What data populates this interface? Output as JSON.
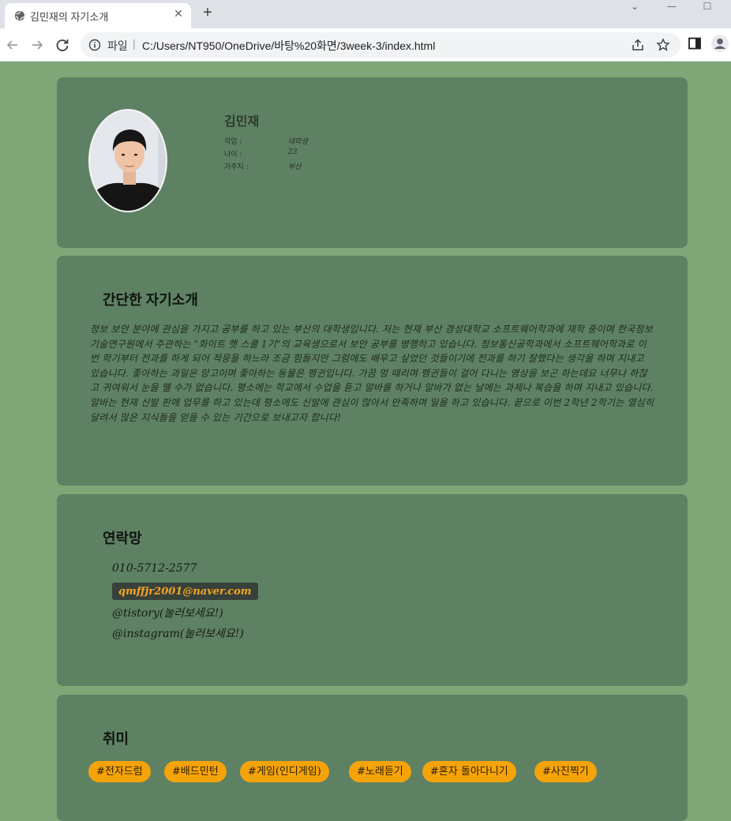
{
  "browser": {
    "tab_title": "김민재의 자기소개",
    "new_tab_glyph": "+",
    "close_glyph": "✕",
    "omnibox": {
      "scheme_label": "파일",
      "separator": "|",
      "url": "C:/Users/NT950/OneDrive/바탕%20화면/3week-3/index.html"
    },
    "window_controls": {
      "chevron": "⌄",
      "minimize": "—",
      "maximize": "☐"
    }
  },
  "profile": {
    "name": "김민재",
    "fields": [
      {
        "label": "직업 :",
        "value": "대학생"
      },
      {
        "label": "나이 :",
        "value": "23"
      },
      {
        "label": "거주지 :",
        "value": "부산"
      }
    ]
  },
  "intro": {
    "title": "간단한 자기소개",
    "body": "정보 보안 분야에 관심을 가지고 공부를 하고 있는 부산의 대학생입니다. 저는 현재 부산 경성대학교 소프트웨어학과에 재학 중이며 한국정보기술연구원에서 주관하는 \"화이트 햇 스쿨 1기\"의 교육생으로서 보안 공부를 병행하고 있습니다. 정보통신공학과에서 소프트웨어학과로 이번 학기부터 전과를 하게 되어 적응을 하느라 조금 힘들지만 그럼에도 배우고 싶었던 것들이기에 전과를 하기 잘했다는 생각을 하며 지내고 있습니다. 좋아하는 과일은 망고이며 좋아하는 동물은 펭귄입니다. 가끔 멍 때리며 펭귄들이 걸어 다니는 영상을 보곤 하는데요 너무나 하찮고 귀여워서 눈을 뗄 수가 없습니다. 평소에는 학교에서 수업을 듣고 알바를 하거나 알바가 없는 날에는 과제나 복습을 하며 지내고 있습니다. 알바는 현재 신발 판매 업무를 하고 있는데 평소에도 신발에 관심이 많아서 만족하며 일을 하고 있습니다. 끝으로 이번 2학년 2학기는 열심히 달려서 많은 지식들을 얻을 수 있는 기간으로 보내고자 합니다!"
  },
  "contact": {
    "title": "연락망",
    "phone": "010-5712-2577",
    "email": "qmffjr2001@naver.com",
    "tistory": "@tistory(눌러보세요!)",
    "instagram": "@instagram(눌러보세요!)"
  },
  "hobby": {
    "title": "취미",
    "tags": [
      "#전자드럼",
      "#배드민턴",
      "#게임(인디게임)",
      "#노래듣기",
      "#혼자 돌아다니기",
      "#사진찍기"
    ]
  },
  "colors": {
    "page_bg": "#7ea676",
    "card_bg": "#5e8163",
    "tag_bg": "#f5a30a",
    "email_chip_bg": "#37413a",
    "email_text": "#f6a623"
  }
}
